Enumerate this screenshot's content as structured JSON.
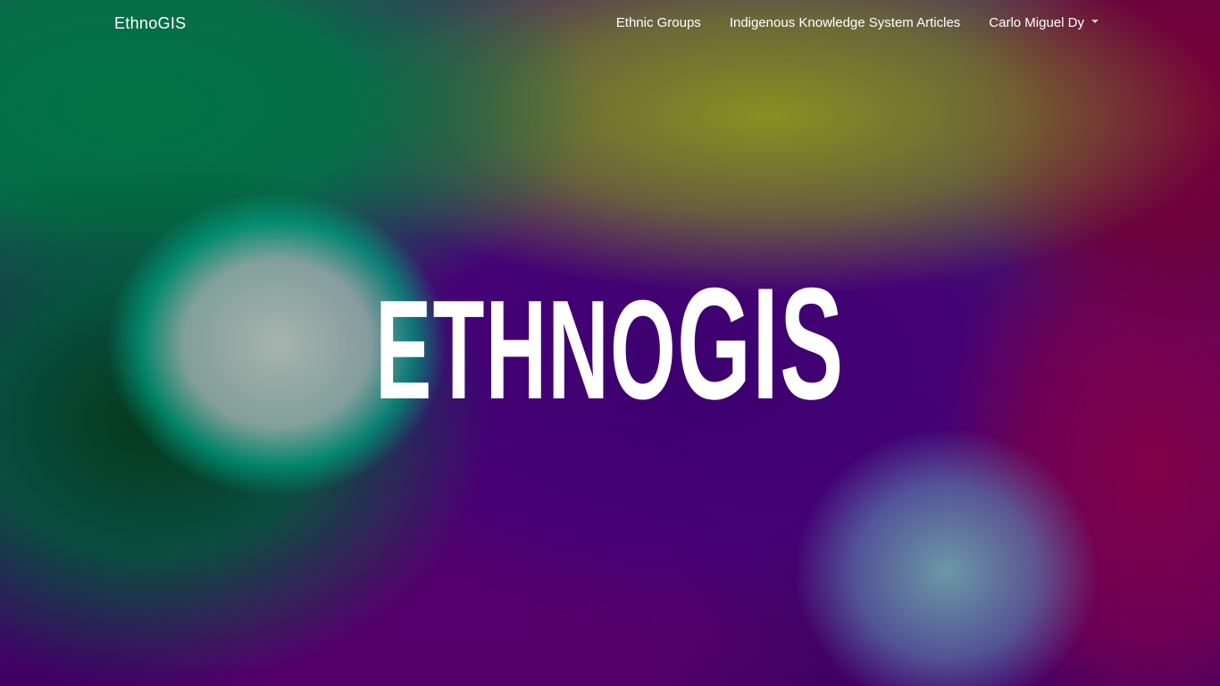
{
  "navbar": {
    "brand": "EthnoGIS",
    "links": [
      {
        "label": "Ethnic Groups"
      },
      {
        "label": "Indigenous Knowledge System Articles"
      }
    ],
    "user_menu": {
      "label": "Carlo Miguel Dy",
      "icon": "caret-down-icon"
    }
  },
  "hero": {
    "title_part1": "ETHNO",
    "title_part2": "GIS"
  },
  "colors": {
    "text": "#ffffff",
    "green": "#007346",
    "purple": "#46007a",
    "olive": "#8c961e",
    "magenta": "#780037"
  }
}
